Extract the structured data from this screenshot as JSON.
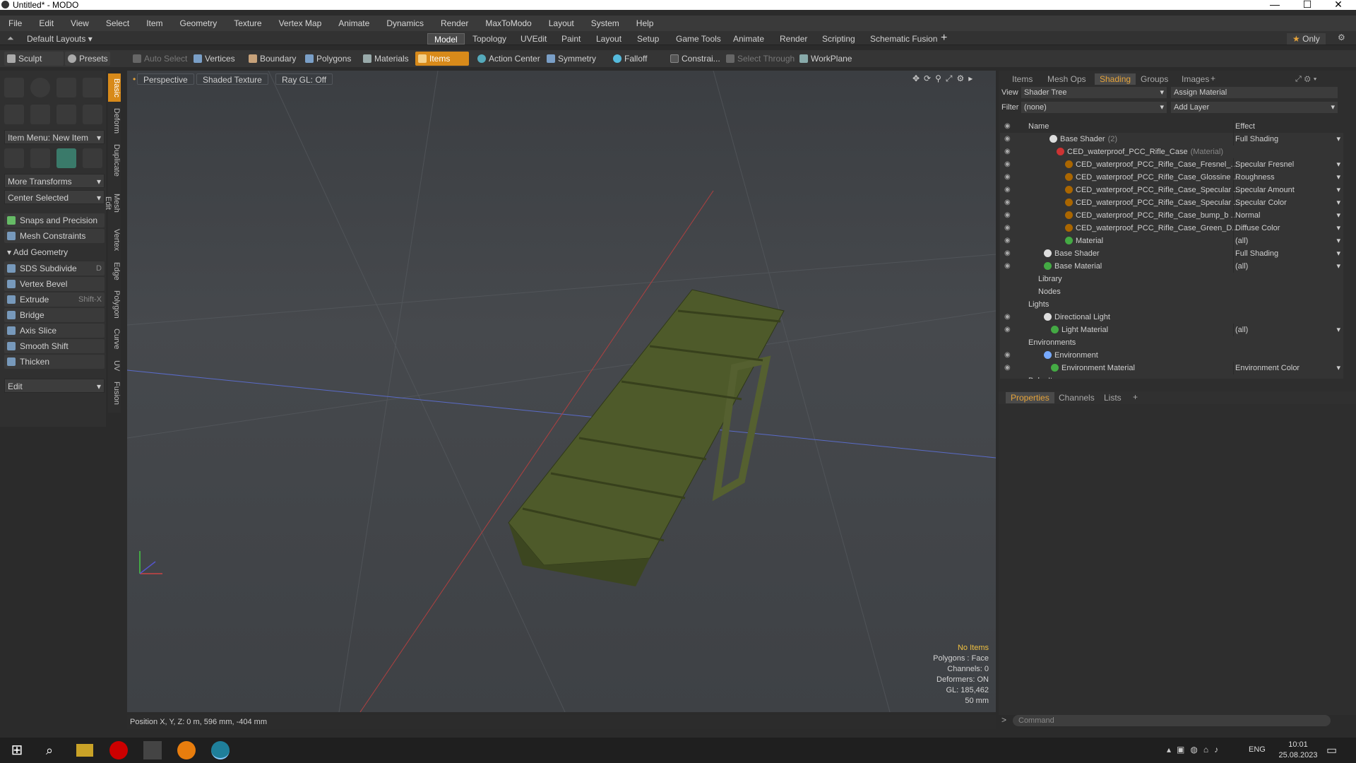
{
  "window": {
    "title": "Untitled* - MODO"
  },
  "menu": [
    "File",
    "Edit",
    "View",
    "Select",
    "Item",
    "Geometry",
    "Texture",
    "Vertex Map",
    "Animate",
    "Dynamics",
    "Render",
    "MaxToModo",
    "Layout",
    "System",
    "Help"
  ],
  "layout": {
    "preset": "Default Layouts",
    "tabs": [
      "Model",
      "Topology",
      "UVEdit",
      "Paint",
      "Layout",
      "Setup",
      "Game Tools",
      "Animate",
      "Render",
      "Scripting",
      "Schematic Fusion"
    ],
    "active_tab": "Model",
    "only_label": "Only"
  },
  "toolbar": {
    "sculpt": "Sculpt",
    "presets": "Presets",
    "auto_select": "Auto Select",
    "vertices": "Vertices",
    "boundary": "Boundary",
    "polygons": "Polygons",
    "materials": "Materials",
    "items": "Items",
    "action_center": "Action Center",
    "symmetry": "Symmetry",
    "falloff": "Falloff",
    "constraints": "Constrai...",
    "select_through": "Select Through",
    "workplane": "WorkPlane"
  },
  "left_panel": {
    "item_menu": "Item Menu: New Item",
    "more_transforms": "More Transforms",
    "center_selected": "Center Selected",
    "snaps": "Snaps and Precision",
    "mesh_constraints": "Mesh Constraints",
    "add_geometry": "Add Geometry",
    "tools": [
      {
        "label": "SDS Subdivide",
        "shortcut": "D"
      },
      {
        "label": "Vertex Bevel",
        "shortcut": ""
      },
      {
        "label": "Extrude",
        "shortcut": "Shift-X"
      },
      {
        "label": "Bridge",
        "shortcut": ""
      },
      {
        "label": "Axis Slice",
        "shortcut": ""
      },
      {
        "label": "Smooth Shift",
        "shortcut": ""
      },
      {
        "label": "Thicken",
        "shortcut": ""
      }
    ],
    "edit_dropdown": "Edit",
    "vertical_tabs": [
      "Basic",
      "Deform",
      "Duplicate",
      "Mesh Edit",
      "Vertex",
      "Edge",
      "Polygon",
      "Curve",
      "UV",
      "Fusion"
    ]
  },
  "viewport": {
    "view": "Perspective",
    "shading": "Shaded Texture",
    "raygl": "Ray GL: Off",
    "hud": [
      "No Items",
      "Polygons : Face",
      "Channels: 0",
      "Deformers: ON",
      "GL: 185,462",
      "50 mm"
    ],
    "position": "Position X, Y, Z:   0 m, 596 mm, -404 mm"
  },
  "right_panel": {
    "tabs": [
      "Items",
      "Mesh Ops",
      "Shading",
      "Groups",
      "Images"
    ],
    "active_tab": "Shading",
    "view_label": "View",
    "view_value": "Shader Tree",
    "assign_material": "Assign Material",
    "filter_label": "Filter",
    "filter_value": "(none)",
    "add_layer": "Add Layer",
    "col_name": "Name",
    "col_effect": "Effect",
    "rows": [
      {
        "name": "Base Shader",
        "suffix": "(2)",
        "effect": "Full Shading",
        "indent": 70,
        "ball": "#ddd"
      },
      {
        "name": "CED_waterproof_PCC_Rifle_Case",
        "suffix": "(Material)",
        "effect": "",
        "indent": 80,
        "ball": "#c33"
      },
      {
        "name": "CED_waterproof_PCC_Rifle_Case_Fresnel_...",
        "suffix": "",
        "effect": "Specular Fresnel",
        "indent": 92,
        "ball": "#a60"
      },
      {
        "name": "CED_waterproof_PCC_Rifle_Case_Glossine ...",
        "suffix": "",
        "effect": "Roughness",
        "indent": 92,
        "ball": "#a60"
      },
      {
        "name": "CED_waterproof_PCC_Rifle_Case_Specular ...",
        "suffix": "",
        "effect": "Specular Amount",
        "indent": 92,
        "ball": "#a60"
      },
      {
        "name": "CED_waterproof_PCC_Rifle_Case_Specular ...",
        "suffix": "",
        "effect": "Specular Color",
        "indent": 92,
        "ball": "#a60"
      },
      {
        "name": "CED_waterproof_PCC_Rifle_Case_bump_b ...",
        "suffix": "",
        "effect": "Normal",
        "indent": 92,
        "ball": "#a60"
      },
      {
        "name": "CED_waterproof_PCC_Rifle_Case_Green_D...",
        "suffix": "",
        "effect": "Diffuse Color",
        "indent": 92,
        "ball": "#a60"
      },
      {
        "name": "Material",
        "suffix": "",
        "effect": "(all)",
        "indent": 92,
        "ball": "#4a4"
      },
      {
        "name": "Base Shader",
        "suffix": "",
        "effect": "Full Shading",
        "indent": 62,
        "ball": "#ddd"
      },
      {
        "name": "Base Material",
        "suffix": "",
        "effect": "(all)",
        "indent": 62,
        "ball": "#4a4"
      },
      {
        "name": "Library",
        "suffix": "",
        "effect": "",
        "indent": 54,
        "ball": ""
      },
      {
        "name": "Nodes",
        "suffix": "",
        "effect": "",
        "indent": 54,
        "ball": ""
      },
      {
        "name": "Lights",
        "suffix": "",
        "effect": "",
        "indent": 40,
        "ball": ""
      },
      {
        "name": "Directional Light",
        "suffix": "",
        "effect": "",
        "indent": 62,
        "ball": "#ddd"
      },
      {
        "name": "Light Material",
        "suffix": "",
        "effect": "(all)",
        "indent": 72,
        "ball": "#4a4"
      },
      {
        "name": "Environments",
        "suffix": "",
        "effect": "",
        "indent": 40,
        "ball": ""
      },
      {
        "name": "Environment",
        "suffix": "",
        "effect": "",
        "indent": 62,
        "ball": "#7af"
      },
      {
        "name": "Environment Material",
        "suffix": "",
        "effect": "Environment Color",
        "indent": 72,
        "ball": "#4a4"
      },
      {
        "name": "Bake Items",
        "suffix": "",
        "effect": "",
        "indent": 40,
        "ball": ""
      }
    ],
    "bottom_tabs": [
      "Properties",
      "Channels",
      "Lists"
    ],
    "command_placeholder": "Command"
  },
  "taskbar": {
    "lang": "ENG",
    "time": "10:01",
    "date": "25.08.2023"
  }
}
